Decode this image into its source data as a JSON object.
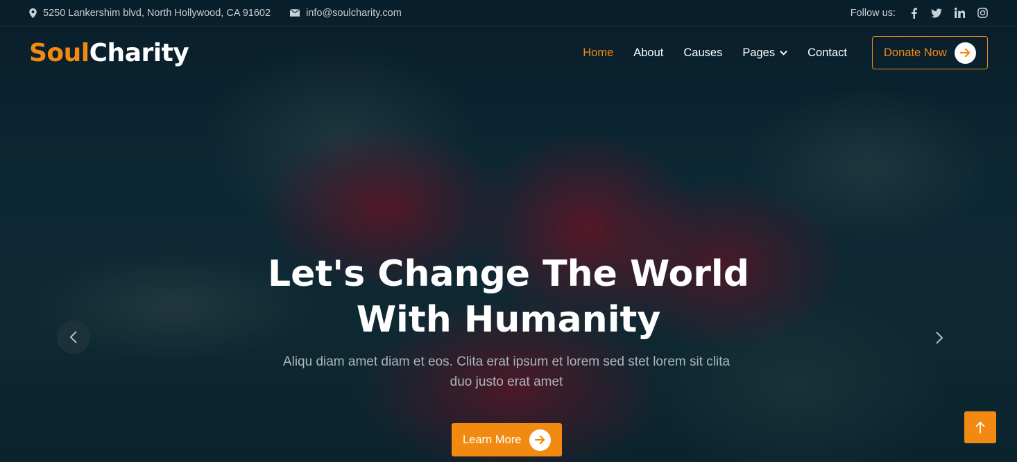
{
  "topbar": {
    "address": "5250 Lankershim blvd, North Hollywood, CA 91602",
    "email": "info@soulcharity.com",
    "follow_label": "Follow us:",
    "social_icons": [
      "facebook-icon",
      "twitter-icon",
      "linkedin-icon",
      "instagram-icon"
    ]
  },
  "brand": {
    "part1": "Soul",
    "part2": "Charity",
    "accent_color": "#f28a12"
  },
  "nav": {
    "items": [
      {
        "label": "Home",
        "active": true
      },
      {
        "label": "About"
      },
      {
        "label": "Causes"
      },
      {
        "label": "Pages",
        "has_dropdown": true
      },
      {
        "label": "Contact"
      }
    ],
    "donate_label": "Donate Now"
  },
  "hero": {
    "title_line1": "Let's Change The World",
    "title_line2": "With Humanity",
    "subtitle_line1": "Aliqu diam amet diam et eos. Clita erat ipsum et lorem sed stet lorem sit clita",
    "subtitle_line2": "duo justo erat amet",
    "cta_label": "Learn More"
  }
}
